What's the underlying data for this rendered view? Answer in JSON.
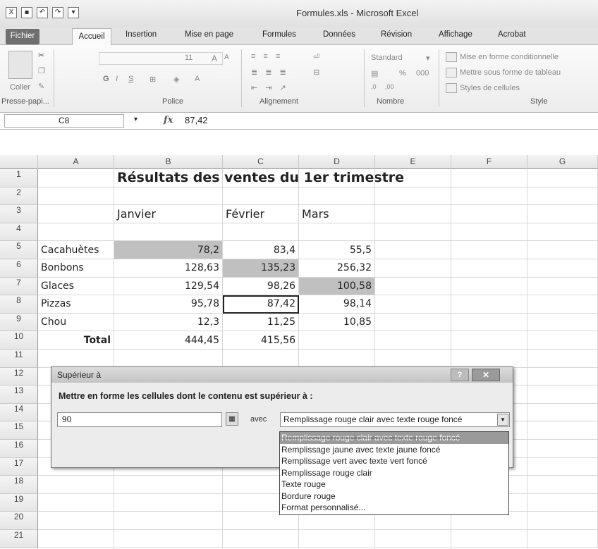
{
  "window": {
    "title": "Formules.xls - Microsoft Excel"
  },
  "tabs": {
    "file": "Fichier",
    "home": "Accueil",
    "insert": "Insertion",
    "layout": "Mise en page",
    "formulas": "Formules",
    "data": "Données",
    "review": "Révision",
    "view": "Affichage",
    "acrobat": "Acrobat"
  },
  "ribbon": {
    "paste": "Coller",
    "clipboard": "Presse-papi...",
    "font_size": "11",
    "font_group": "Police",
    "bold": "G",
    "italic": "I",
    "underline": "S",
    "align_group": "Alignement",
    "number_format": "Standard",
    "number_group": "Nombre",
    "pct": "%",
    "thousands": "000",
    "cond_format": "Mise en forme conditionnelle",
    "table_format": "Mettre sous forme de tableau",
    "cell_styles": "Styles de cellules",
    "style_group": "Style"
  },
  "formula_bar": {
    "name_box": "C8",
    "fx": "fx",
    "value": "87,42"
  },
  "columns": [
    "A",
    "B",
    "C",
    "D",
    "E",
    "F",
    "G"
  ],
  "rows": [
    "1",
    "2",
    "3",
    "4",
    "5",
    "6",
    "7",
    "8",
    "9",
    "10",
    "11",
    "12",
    "13",
    "14",
    "15",
    "16",
    "17",
    "18",
    "19",
    "20",
    "21"
  ],
  "sheet": {
    "title": "Résultats des ventes du 1er trimestre",
    "months": [
      "Janvier",
      "Février",
      "Mars"
    ],
    "data": [
      {
        "label": "Cacahuètes",
        "values": [
          "78,2",
          "83,4",
          "55,5"
        ]
      },
      {
        "label": "Bonbons",
        "values": [
          "128,63",
          "135,23",
          "256,32"
        ]
      },
      {
        "label": "Glaces",
        "values": [
          "129,54",
          "98,26",
          "100,58"
        ]
      },
      {
        "label": "Pizzas",
        "values": [
          "95,78",
          "87,42",
          "98,14"
        ]
      },
      {
        "label": "Chou",
        "values": [
          "12,3",
          "11,25",
          "10,85"
        ]
      }
    ],
    "total": {
      "label": "Total",
      "values": [
        "444,45",
        "415,56",
        ""
      ]
    }
  },
  "dialog": {
    "title": "Supérieur à",
    "help": "?",
    "close": "✕",
    "prompt": "Mettre en forme les cellules dont le contenu est supérieur à :",
    "value": "90",
    "avec": "avec",
    "selected": "Remplissage rouge clair avec texte rouge foncé",
    "options": [
      "Remplissage rouge clair avec texte rouge foncé",
      "Remplissage jaune avec texte jaune foncé",
      "Remplissage vert avec texte vert foncé",
      "Remplissage rouge clair",
      "Texte rouge",
      "Bordure rouge",
      "Format personnalisé..."
    ]
  }
}
